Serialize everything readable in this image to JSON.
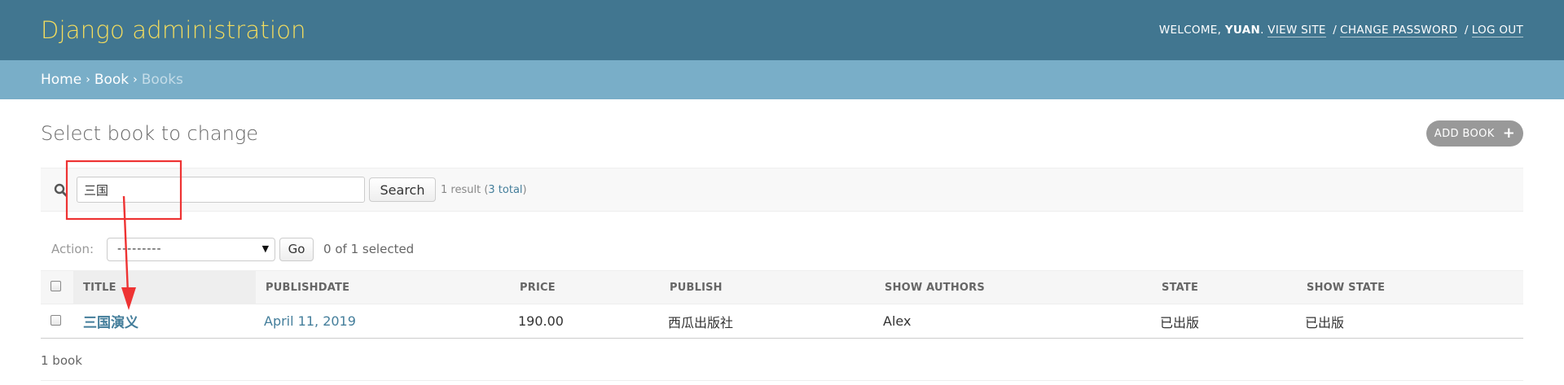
{
  "header": {
    "site_name": "Django administration",
    "welcome": "Welcome,",
    "username": "yuan",
    "period": ".",
    "view_site": "View site",
    "change_password": "Change password",
    "log_out": "Log out",
    "separator": "/"
  },
  "breadcrumbs": {
    "home": "Home",
    "app": "Book",
    "current": "Books",
    "arrow": "›"
  },
  "page": {
    "title": "Select book to change",
    "add_label": "Add book",
    "add_icon": "+"
  },
  "search": {
    "value": "三国",
    "button": "Search",
    "result_prefix": "1 result (",
    "total_link": "3 total",
    "result_suffix": ")"
  },
  "actions": {
    "label": "Action:",
    "selected_value": "---------",
    "go": "Go",
    "selected_info": "0 of 1 selected"
  },
  "table": {
    "columns": [
      "Title",
      "PublishDate",
      "Price",
      "Publish",
      "Show authors",
      "State",
      "Show state"
    ],
    "rows": [
      {
        "title": "三国演义",
        "publishdate": "April 11, 2019",
        "price": "190.00",
        "publish": "西瓜出版社",
        "authors": "Alex",
        "state": "已出版",
        "show_state": "已出版"
      }
    ]
  },
  "paginator": {
    "text": "1 book"
  },
  "colors": {
    "header_bg": "#417690",
    "breadcrumbs_bg": "#79aec8",
    "site_name": "#f5dd5d",
    "link": "#447e9b",
    "annotation": "#ee3333"
  },
  "icons": {
    "search": "magnifier-icon",
    "caret": "caret-down-icon"
  }
}
